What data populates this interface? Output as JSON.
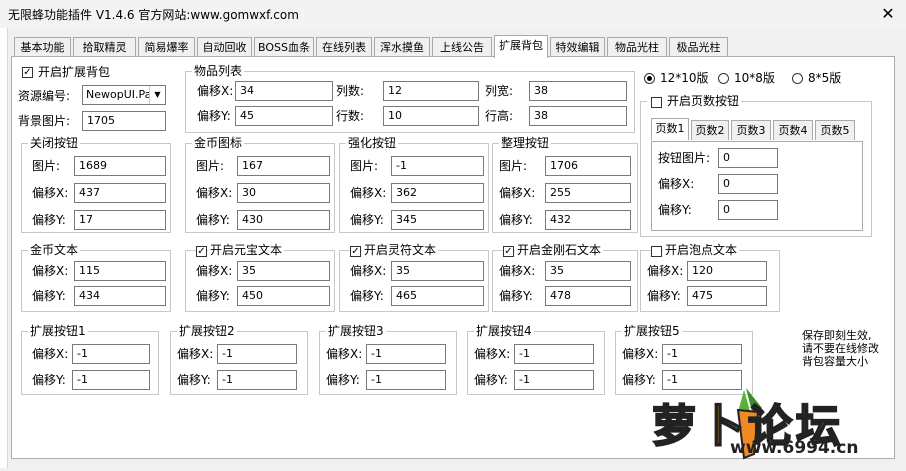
{
  "window": {
    "title": "无限蜂功能插件 V1.4.6  官方网站:www.gomwxf.com",
    "close": "✕"
  },
  "tabs": [
    "基本功能",
    "拾取精灵",
    "简易爆率",
    "自动回收",
    "BOSS血条",
    "在线列表",
    "浑水摸鱼",
    "上线公告",
    "扩展背包",
    "特效编辑",
    "物品光柱",
    "极品光柱"
  ],
  "active_tab": "扩展背包",
  "enable_bag": {
    "label": "开启扩展背包",
    "checked": "✓"
  },
  "resource": {
    "label": "资源编号:",
    "value": "NewopUI.Pak",
    "arrow": "▼"
  },
  "bg": {
    "label": "背景图片:",
    "value": "1705"
  },
  "items_list": {
    "title": "物品列表",
    "offset_x_label": "偏移X:",
    "offset_x": "34",
    "offset_y_label": "偏移Y:",
    "offset_y": "45",
    "cols_label": "列数:",
    "cols": "12",
    "rows_label": "行数:",
    "rows": "10",
    "col_w_label": "列宽:",
    "col_w": "38",
    "row_h_label": "行高:",
    "row_h": "38"
  },
  "versions": [
    "12*10版",
    "10*8版",
    "8*5版"
  ],
  "page_group": {
    "title": "开启页数按钮",
    "tabs": [
      "页数1",
      "页数2",
      "页数3",
      "页数4",
      "页数5"
    ],
    "img_label": "按钮图片:",
    "img": "0",
    "x_label": "偏移X:",
    "x": "0",
    "y_label": "偏移Y:",
    "y": "0"
  },
  "close_btn": {
    "title": "关闭按钮",
    "img_label": "图片:",
    "img": "1689",
    "x_label": "偏移X:",
    "x": "437",
    "y_label": "偏移Y:",
    "y": "17"
  },
  "gold_icon": {
    "title": "金币图标",
    "img_label": "图片:",
    "img": "167",
    "x_label": "偏移X:",
    "x": "30",
    "y_label": "偏移Y:",
    "y": "430"
  },
  "enhance_btn": {
    "title": "强化按钮",
    "img_label": "图片:",
    "img": "-1",
    "x_label": "偏移X:",
    "x": "362",
    "y_label": "偏移Y:",
    "y": "345"
  },
  "sort_btn": {
    "title": "整理按钮",
    "img_label": "图片:",
    "img": "1706",
    "x_label": "偏移X:",
    "x": "255",
    "y_label": "偏移Y:",
    "y": "432"
  },
  "gold_text": {
    "title": "金币文本",
    "x_label": "偏移X:",
    "x": "115",
    "y_label": "偏移Y:",
    "y": "434"
  },
  "yuanbao_text": {
    "title": "开启元宝文本",
    "checked": "✓",
    "x_label": "偏移X:",
    "x": "35",
    "y_label": "偏移Y:",
    "y": "450"
  },
  "lingfu_text": {
    "title": "开启灵符文本",
    "checked": "✓",
    "x_label": "偏移X:",
    "x": "35",
    "y_label": "偏移Y:",
    "y": "465"
  },
  "diamond_text": {
    "title": "开启金刚石文本",
    "checked": "✓",
    "x_label": "偏移X:",
    "x": "35",
    "y_label": "偏移Y:",
    "y": "478"
  },
  "bubble_text": {
    "title": "开启泡点文本",
    "x_label": "偏移X:",
    "x": "120",
    "y_label": "偏移Y:",
    "y": "475"
  },
  "ext_btns": [
    {
      "title": "扩展按钮1",
      "x_label": "偏移X:",
      "x": "-1",
      "y_label": "偏移Y:",
      "y": "-1"
    },
    {
      "title": "扩展按钮2",
      "x_label": "偏移X:",
      "x": "-1",
      "y_label": "偏移Y:",
      "y": "-1"
    },
    {
      "title": "扩展按钮3",
      "x_label": "偏移X:",
      "x": "-1",
      "y_label": "偏移Y:",
      "y": "-1"
    },
    {
      "title": "扩展按钮4",
      "x_label": "偏移X:",
      "x": "-1",
      "y_label": "偏移Y:",
      "y": "-1"
    },
    {
      "title": "扩展按钮5",
      "x_label": "偏移X:",
      "x": "-1",
      "y_label": "偏移Y:",
      "y": "-1"
    }
  ],
  "note": [
    "保存即刻生效,",
    "请不要在线修改",
    "背包容量大小"
  ],
  "watermark": {
    "text": "萝卜论坛",
    "url": "www.6994.cn"
  },
  "colors": {
    "accent_blue": "#0078d7",
    "watermark_orange": "#f5a21b",
    "watermark_dark": "#222222"
  }
}
